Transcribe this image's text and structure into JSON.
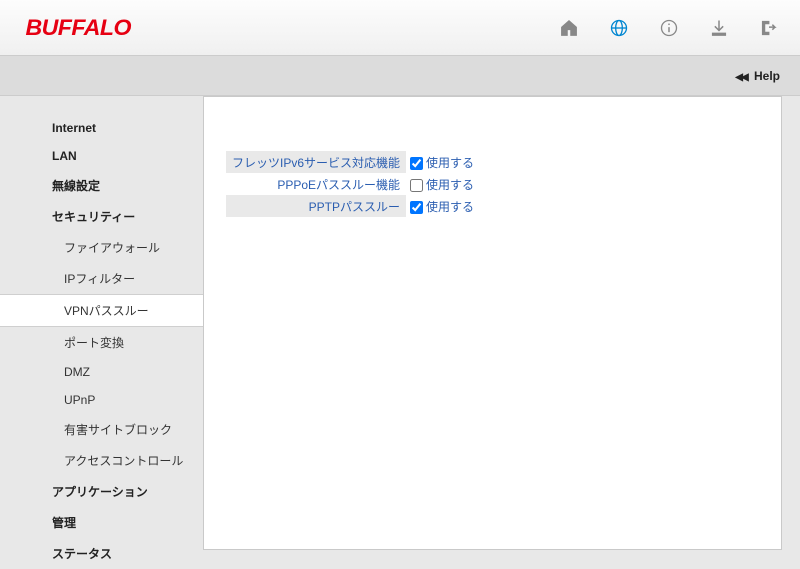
{
  "logo": "BUFFALO",
  "help_label": "Help",
  "sidebar": {
    "items": [
      {
        "label": "Internet",
        "type": "item"
      },
      {
        "label": "LAN",
        "type": "item"
      },
      {
        "label": "無線設定",
        "type": "item"
      },
      {
        "label": "セキュリティー",
        "type": "item"
      },
      {
        "label": "ファイアウォール",
        "type": "sub"
      },
      {
        "label": "IPフィルター",
        "type": "sub"
      },
      {
        "label": "VPNパススルー",
        "type": "sub",
        "active": true
      },
      {
        "label": "ポート変換",
        "type": "sub"
      },
      {
        "label": "DMZ",
        "type": "sub"
      },
      {
        "label": "UPnP",
        "type": "sub"
      },
      {
        "label": "有害サイトブロック",
        "type": "sub"
      },
      {
        "label": "アクセスコントロール",
        "type": "sub"
      },
      {
        "label": "アプリケーション",
        "type": "item"
      },
      {
        "label": "管理",
        "type": "item"
      },
      {
        "label": "ステータス",
        "type": "item"
      }
    ]
  },
  "settings": {
    "rows": [
      {
        "label": "フレッツIPv6サービス対応機能",
        "checked": true,
        "text": "使用する"
      },
      {
        "label": "PPPoEパススルー機能",
        "checked": false,
        "text": "使用する"
      },
      {
        "label": "PPTPパススルー",
        "checked": true,
        "text": "使用する"
      }
    ]
  }
}
